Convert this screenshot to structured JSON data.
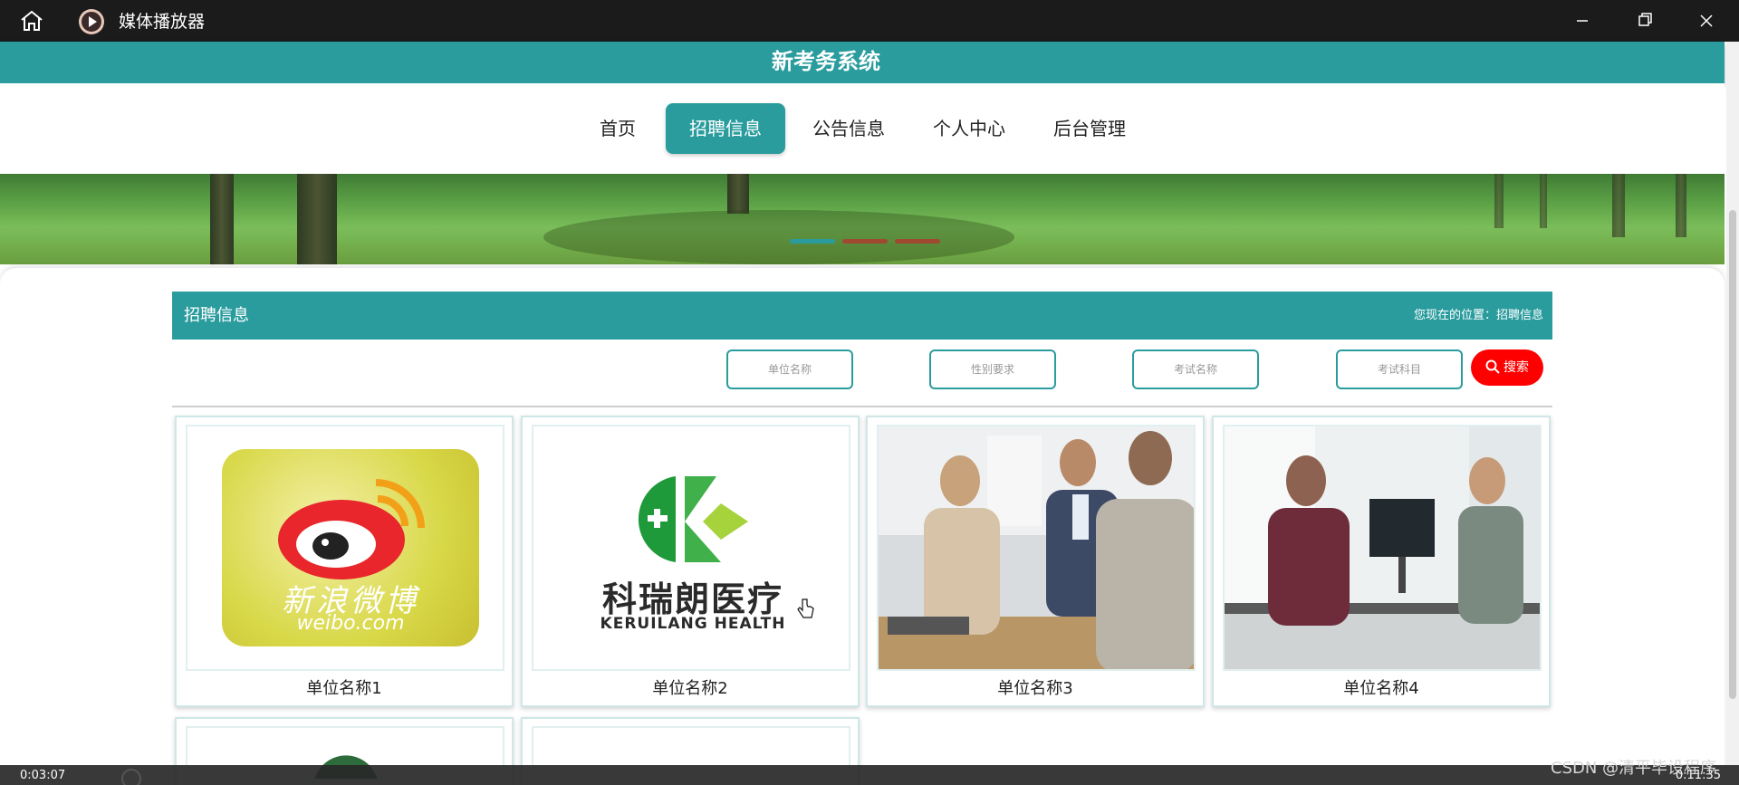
{
  "player": {
    "title": "媒体播放器",
    "time_elapsed": "0:03:07",
    "time_total": "0:11:35",
    "icons": [
      "home-icon",
      "play-icon",
      "minimize-icon",
      "restore-icon",
      "close-icon"
    ]
  },
  "site": {
    "title": "新考务系统"
  },
  "nav": {
    "items": [
      {
        "label": "首页"
      },
      {
        "label": "招聘信息"
      },
      {
        "label": "公告信息"
      },
      {
        "label": "个人中心"
      },
      {
        "label": "后台管理"
      }
    ],
    "active": "招聘信息"
  },
  "section": {
    "title": "招聘信息",
    "breadcrumb": "您现在的位置：招聘信息"
  },
  "filters": {
    "unit_name_placeholder": "单位名称",
    "gender_placeholder": "性别要求",
    "post_name_placeholder": "考试名称",
    "subject_placeholder": "考试科目",
    "search_label": "搜索"
  },
  "cards": [
    {
      "name": "单位名称1",
      "logo_text": "新浪微博",
      "logo_sub": "weibo.com"
    },
    {
      "name": "单位名称2",
      "logo_text": "科瑞朗医疗",
      "logo_sub": "KERUILANG HEALTH"
    },
    {
      "name": "单位名称3"
    },
    {
      "name": "单位名称4"
    }
  ],
  "watermark": "CSDN @清平毕设程序",
  "colors": {
    "primary": "#2a9c9e",
    "search": "#ff0000",
    "titlebar": "#1b1b1b"
  }
}
